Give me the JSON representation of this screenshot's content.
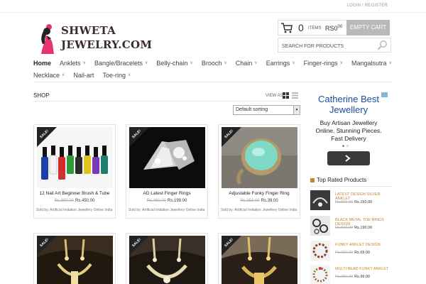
{
  "header": {
    "login_register": "LOGIN / REGISTER",
    "brand_line1": "SHWETA",
    "brand_line2": "JEWELRY.COM",
    "cart_count": "0",
    "cart_items_label": "ITEMS",
    "cart_currency": "RS",
    "cart_total": "0",
    "cart_total_cents": "00",
    "empty_cart": "EMPTY CART",
    "search_placeholder": "SEARCH FOR PRODUCTS"
  },
  "nav": {
    "row1": [
      {
        "label": "Home",
        "dropdown": false,
        "active": true
      },
      {
        "label": "Anklets",
        "dropdown": true
      },
      {
        "label": "Bangle/Bracelets",
        "dropdown": true
      },
      {
        "label": "Belly-chain",
        "dropdown": true
      },
      {
        "label": "Brooch",
        "dropdown": true
      },
      {
        "label": "Chain",
        "dropdown": true
      },
      {
        "label": "Earrings",
        "dropdown": true
      },
      {
        "label": "Finger-rings",
        "dropdown": true
      },
      {
        "label": "Mangalsutra",
        "dropdown": true
      }
    ],
    "row2": [
      {
        "label": "Necklace",
        "dropdown": true
      },
      {
        "label": "Nail-art",
        "dropdown": false
      },
      {
        "label": "Toe-ring",
        "dropdown": true
      }
    ]
  },
  "shop": {
    "title": "SHOP",
    "view_as": "VIEW AS:",
    "sorting": "Default sorting",
    "sale_badge": "SALE!",
    "products": [
      {
        "name": "12 Nail Art Beginner Brush & Tube",
        "old_price": "Rs.800.00",
        "price": "Rs.450.00",
        "seller": "Sold by: Artificial Imitation Jewellery Online India"
      },
      {
        "name": "AD Latest Finger Rings",
        "old_price": "Rs.460.00",
        "price": "Rs.199.00",
        "seller": "Sold by: Artificial Imitation Jewellery Online India"
      },
      {
        "name": "Adjustable Funky Finger Ring",
        "old_price": "Rs.350.00",
        "price": "Rs.39.00",
        "seller": "Sold by: Artificial Imitation Jewellery Online India"
      }
    ]
  },
  "ad": {
    "title": "Catherine Best Jewellery",
    "description": "Buy Artisan Jewellery Online. Stunning Pieces. Fast Delivery"
  },
  "sidebar": {
    "top_rated_title": "Top Rated Products",
    "items": [
      {
        "name": "LATEST DESIGN SILVER ANKLET",
        "old_price": "Rs.500.00",
        "price": "Rs.150.00"
      },
      {
        "name": "BLACK METAL TOE RINGS DESIGN",
        "old_price": "Rs.500.00",
        "price": "Rs.190.00"
      },
      {
        "name": "FUNKY ANKLET DESIGN",
        "old_price": "Rs.200.00",
        "price": "Rs.69.00"
      },
      {
        "name": "MULTI BEAD FUNKY ANKLET",
        "old_price": "Rs.200.00",
        "price": "Rs.99.00"
      }
    ]
  },
  "colors": {
    "accent": "#c7842f",
    "ad_blue": "#1a4fa0",
    "empty_cart_bg": "#b9b9b9"
  }
}
